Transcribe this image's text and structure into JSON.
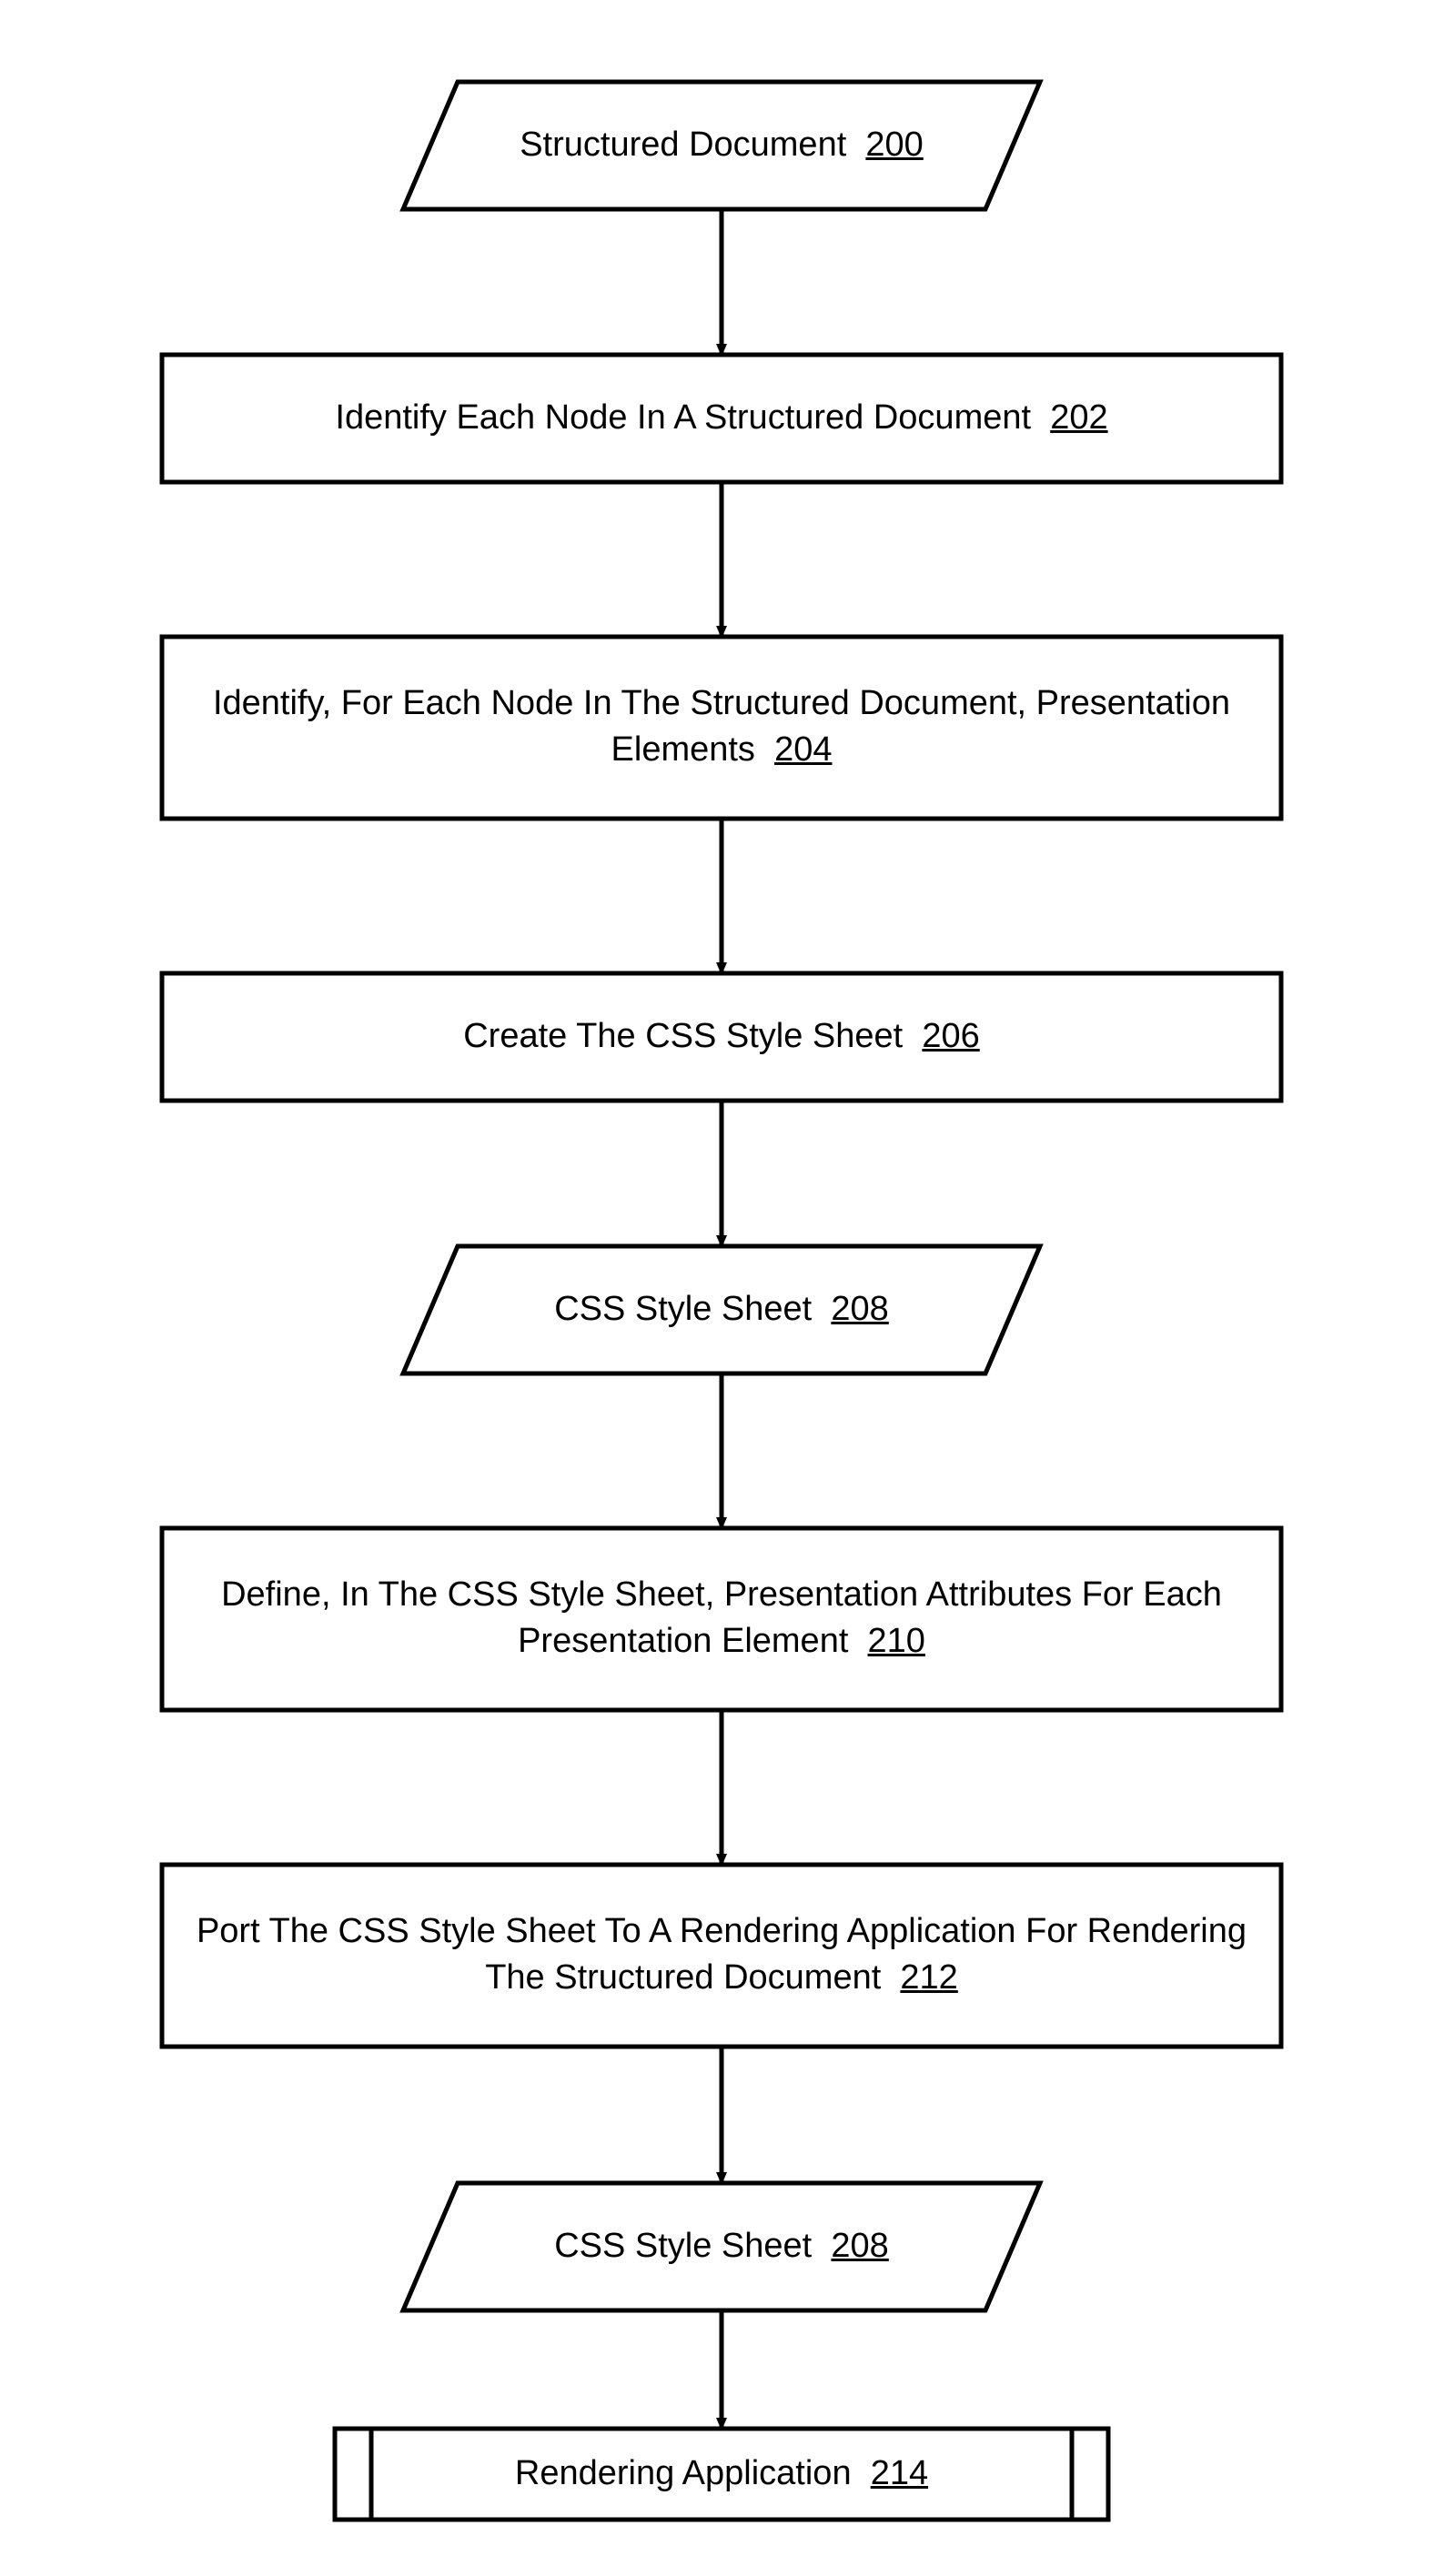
{
  "nodes": [
    {
      "id": "n200",
      "shape": "parallelogram",
      "label": "Structured Document",
      "ref": "200"
    },
    {
      "id": "n202",
      "shape": "process",
      "label": "Identify Each Node In A Structured Document",
      "ref": "202"
    },
    {
      "id": "n204",
      "shape": "process",
      "label": "Identify, For Each Node In The Structured Document, Presentation Elements",
      "ref": "204"
    },
    {
      "id": "n206",
      "shape": "process",
      "label": "Create The CSS Style Sheet",
      "ref": "206"
    },
    {
      "id": "n208",
      "shape": "parallelogram",
      "label": "CSS Style Sheet",
      "ref": "208"
    },
    {
      "id": "n210",
      "shape": "process",
      "label": "Define, In The CSS Style Sheet, Presentation Attributes For Each Presentation Element",
      "ref": "210"
    },
    {
      "id": "n212",
      "shape": "process",
      "label": "Port The CSS Style Sheet To A Rendering Application For Rendering The Structured Document",
      "ref": "212"
    },
    {
      "id": "n208b",
      "shape": "parallelogram",
      "label": "CSS Style Sheet",
      "ref": "208"
    },
    {
      "id": "n214",
      "shape": "predefined",
      "label": "Rendering Application",
      "ref": "214"
    }
  ],
  "edges": [
    [
      "n200",
      "n202"
    ],
    [
      "n202",
      "n204"
    ],
    [
      "n204",
      "n206"
    ],
    [
      "n206",
      "n208"
    ],
    [
      "n208",
      "n210"
    ],
    [
      "n210",
      "n212"
    ],
    [
      "n212",
      "n208b"
    ],
    [
      "n208b",
      "n214"
    ]
  ]
}
